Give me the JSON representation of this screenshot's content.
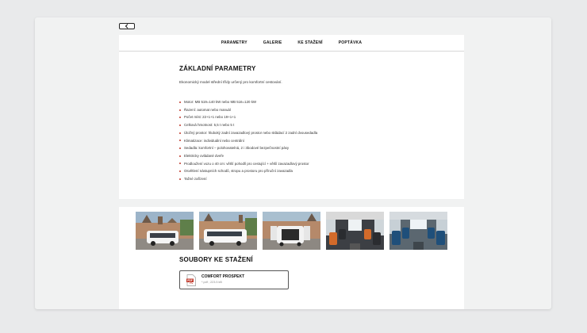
{
  "nav": {
    "back_label": "Zpět",
    "items": [
      "PARAMETRY",
      "GALERIE",
      "KE STAŽENÍ",
      "POPTÁVKA"
    ]
  },
  "parameters": {
    "title": "ZÁKLADNÍ PARAMETRY",
    "intro": "Ekonomický model střední třídy určený pro komfortní cestování.",
    "items": [
      "Motor: MB 519=140 kW nebo MB 516=120 kW",
      "Řazení: automat nebo manuál",
      "Počet míst: 22+1+1 nebo 19+1+1",
      "Celková hmotnost: 5,5 t nebo 5 t",
      "Úložný prostor: hluboký zadní zavazadlový prostor nebo skládací 2 zadní dvousedadla",
      "Klimatizace: individuální nebo centrální",
      "Sedadla: komfortní – polohovatelná, 2 i 3bodové bezpečnostní pásy",
      "Elektricky ovládané dveře",
      "Prodloužení vozu o 40 cm: větší pohodlí pro cestující + větší zavazadlový prostor",
      "Osvětlení nástupních schodů, stropu a prostoru pro příruční zavazadla",
      "Tažné zařízení"
    ]
  },
  "gallery": {
    "images": [
      "bus-exterior-front",
      "bus-exterior-side",
      "bus-exterior-rear-open",
      "bus-interior-orange-seats",
      "bus-interior-blue-seats"
    ]
  },
  "downloads": {
    "title": "SOUBORY KE STAŽENÍ",
    "file_name": "COMFORT PROSPEKT",
    "file_meta": "*.pdf ; 223.5 kB",
    "file_icon": "pdf-icon"
  },
  "colors": {
    "accent": "#c0392b",
    "background": "#e9eaeb"
  }
}
